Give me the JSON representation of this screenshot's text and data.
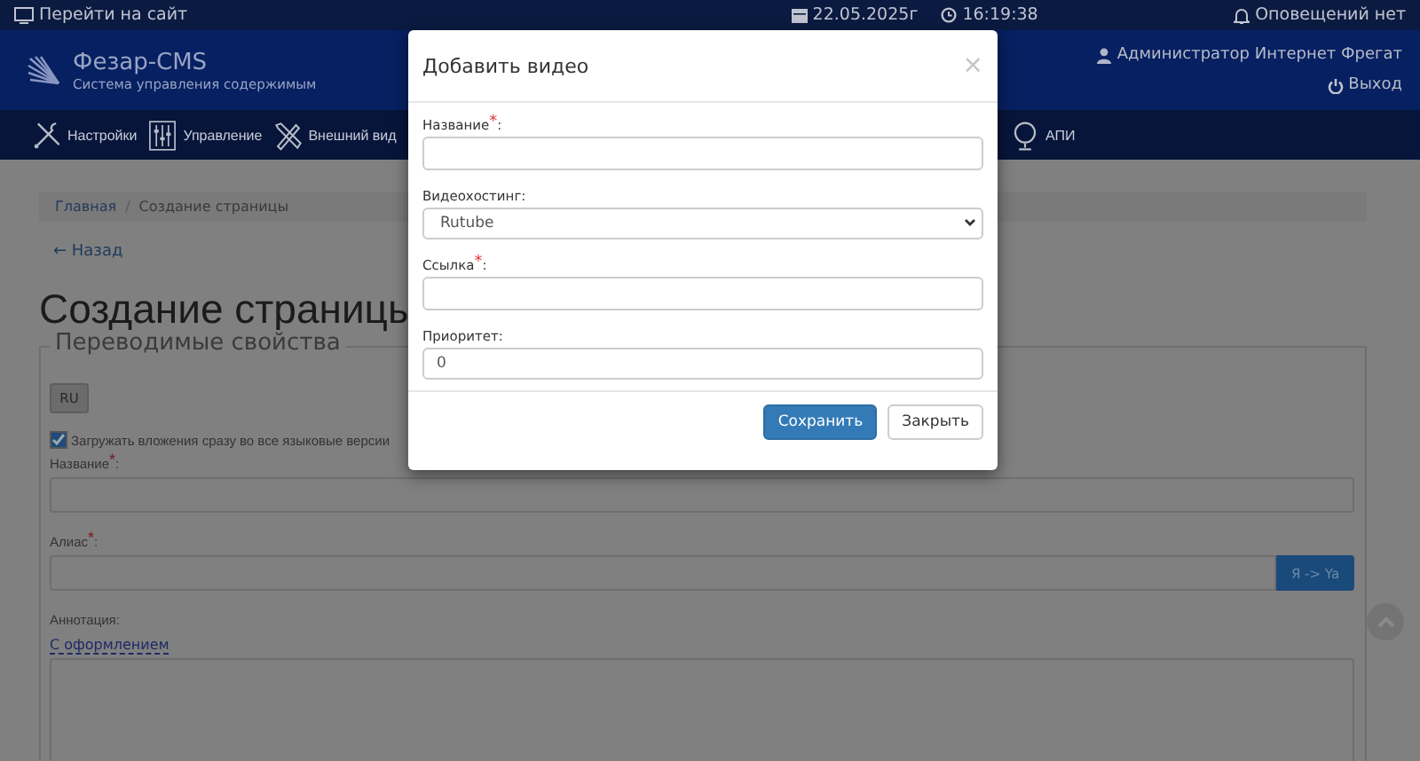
{
  "top_bar": {
    "site_link": "Перейти на сайт",
    "date": "22.05.2025г",
    "time": "16:19:38",
    "notifications": "Оповещений нет"
  },
  "header": {
    "title": "Фезар-CMS",
    "subtitle": "Система управления содержимым",
    "user": "Администратор Интернет Фрегат",
    "logout": "Выход"
  },
  "nav": {
    "left": [
      {
        "label": "Настройки",
        "kind": "tools"
      },
      {
        "label": "Управление",
        "kind": "sliders"
      },
      {
        "label": "Внешний вид",
        "kind": "design"
      }
    ],
    "right": [
      {
        "label": "АПИ",
        "kind": "globe"
      }
    ]
  },
  "breadcrumbs": [
    {
      "label": "Главная",
      "selected": false
    },
    {
      "label": "Создание страницы",
      "selected": true
    }
  ],
  "breadcrumb_separator": "/",
  "back_link": "← Назад",
  "page_title": "Создание страницы",
  "fieldset": {
    "legend": "Переводимые свойства",
    "languages": [
      {
        "label": "RU",
        "selected": true
      }
    ],
    "attach_all": {
      "label": "Загружать вложения сразу во все языковые версии",
      "checked": true
    },
    "name_label": "Название$^{*}$:",
    "alias_label": "Алиас$^{*}$:",
    "translit_button": "Я -> Ya",
    "annotation_label": "Аннотация:",
    "formatting_link": "С оформлением"
  },
  "modal": {
    "title": "Добавить видео",
    "close": "×",
    "fields": [
      {
        "label": "Название$^{*}$:",
        "kind": "text"
      },
      {
        "label": "Видеохостинг:",
        "kind": "select",
        "value": "Rutube"
      },
      {
        "label": "Ссылка$^{*}$:",
        "kind": "text"
      },
      {
        "label": "Приоритет:",
        "kind": "text",
        "value": "0"
      }
    ],
    "buttons": [
      {
        "label": "Сохранить",
        "kind": "primary"
      },
      {
        "label": "Закрыть",
        "kind": "default"
      }
    ]
  }
}
